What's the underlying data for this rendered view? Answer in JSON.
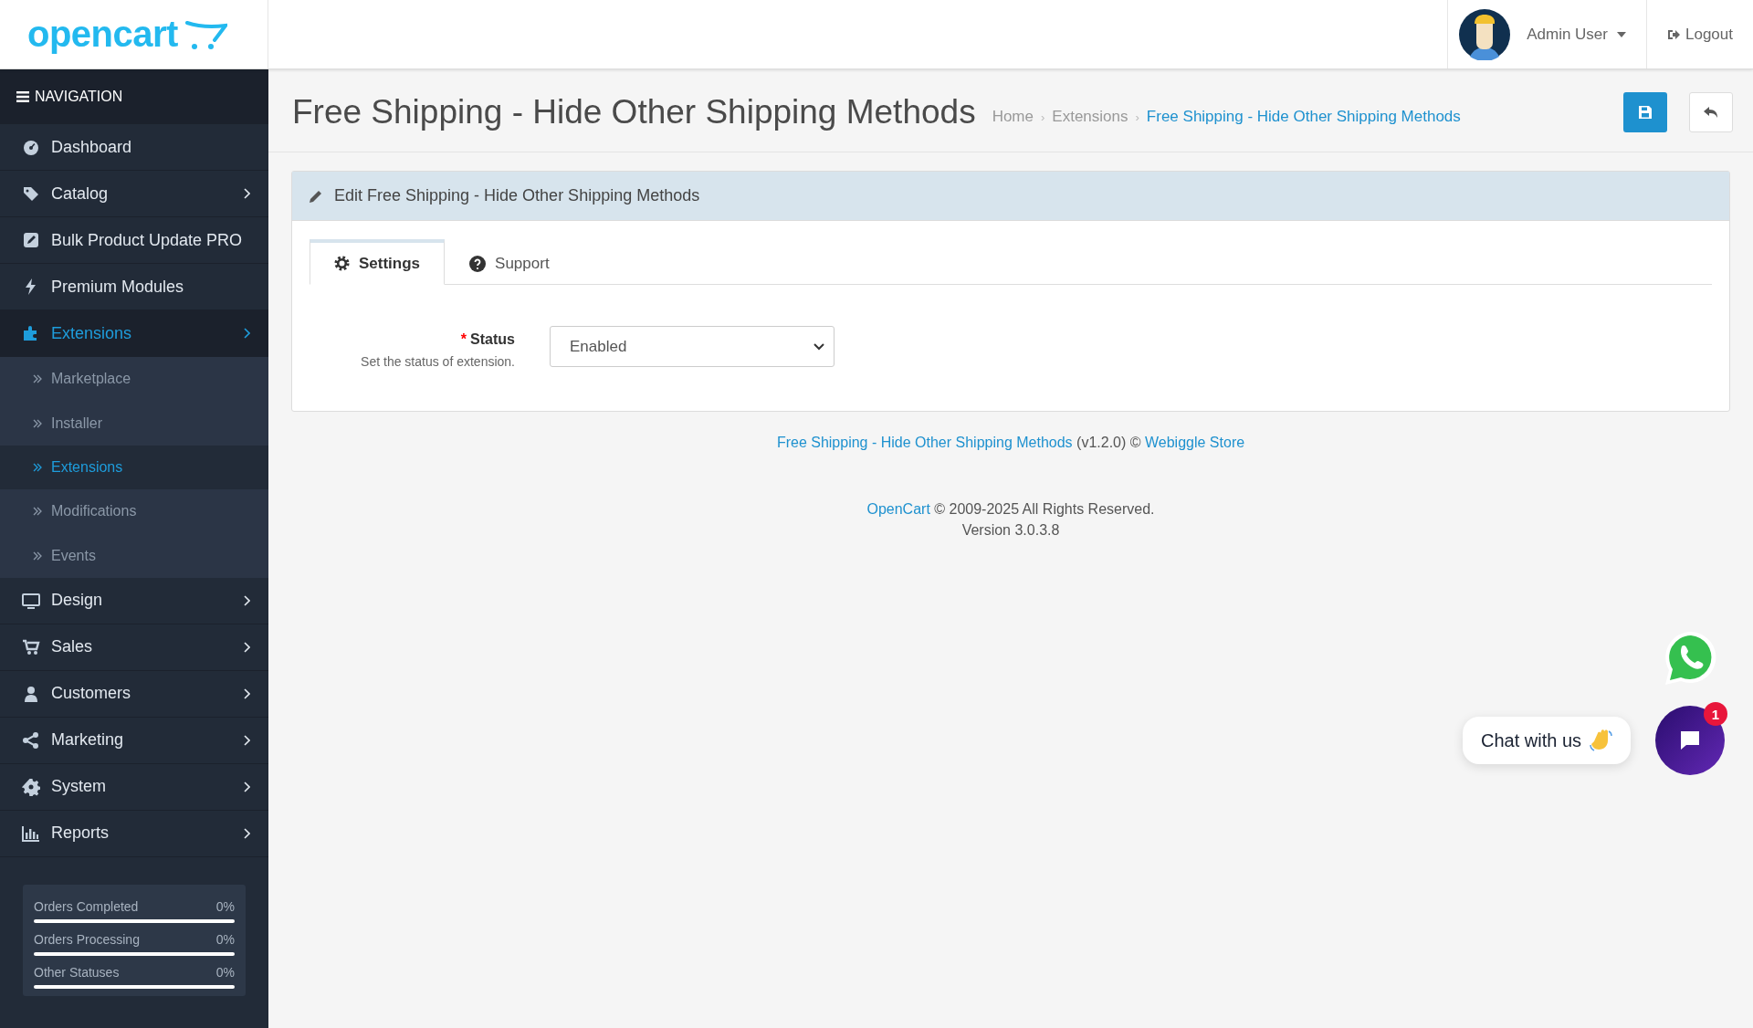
{
  "header": {
    "logo": "opencart",
    "user": "Admin User",
    "logout": "Logout"
  },
  "sidebar": {
    "title": "NAVIGATION",
    "items": [
      {
        "label": "Dashboard",
        "expandable": false,
        "selected": false
      },
      {
        "label": "Catalog",
        "expandable": true,
        "selected": false
      },
      {
        "label": "Bulk Product Update PRO",
        "expandable": false,
        "selected": false
      },
      {
        "label": "Premium Modules",
        "expandable": false,
        "selected": false
      },
      {
        "label": "Extensions",
        "expandable": true,
        "selected": true,
        "children": [
          {
            "label": "Marketplace",
            "selected": false
          },
          {
            "label": "Installer",
            "selected": false
          },
          {
            "label": "Extensions",
            "selected": true
          },
          {
            "label": "Modifications",
            "selected": false
          },
          {
            "label": "Events",
            "selected": false
          }
        ]
      },
      {
        "label": "Design",
        "expandable": true,
        "selected": false
      },
      {
        "label": "Sales",
        "expandable": true,
        "selected": false
      },
      {
        "label": "Customers",
        "expandable": true,
        "selected": false
      },
      {
        "label": "Marketing",
        "expandable": true,
        "selected": false
      },
      {
        "label": "System",
        "expandable": true,
        "selected": false
      },
      {
        "label": "Reports",
        "expandable": true,
        "selected": false
      }
    ],
    "stats": [
      {
        "label": "Orders Completed",
        "reading": "0%",
        "level": 0
      },
      {
        "label": "Orders Processing",
        "reading": "0%",
        "level": 0
      },
      {
        "label": "Other Statuses",
        "reading": "0%",
        "level": 0
      }
    ]
  },
  "page": {
    "title": "Free Shipping - Hide Other Shipping Methods",
    "breadcrumbs": [
      "Home",
      "Extensions",
      "Free Shipping - Hide Other Shipping Methods"
    ],
    "separator": "›"
  },
  "panel": {
    "heading": "Edit Free Shipping - Hide Other Shipping Methods",
    "tabs": [
      {
        "label": "Settings",
        "selected": true
      },
      {
        "label": "Support",
        "selected": false
      }
    ],
    "status": {
      "label": "Status",
      "required_mark": "*",
      "help": "Set the status of extension.",
      "value": "Enabled"
    }
  },
  "footer": {
    "module_link": "Free Shipping - Hide Other Shipping Methods",
    "version_note": "(v1.2.0) ©",
    "store_link": "Webiggle Store",
    "opencart_link": "OpenCart",
    "rights": "© 2009-2025 All Rights Reserved.",
    "version": "Version 3.0.3.8"
  },
  "chat": {
    "label": "Chat with us",
    "badge": "1"
  }
}
